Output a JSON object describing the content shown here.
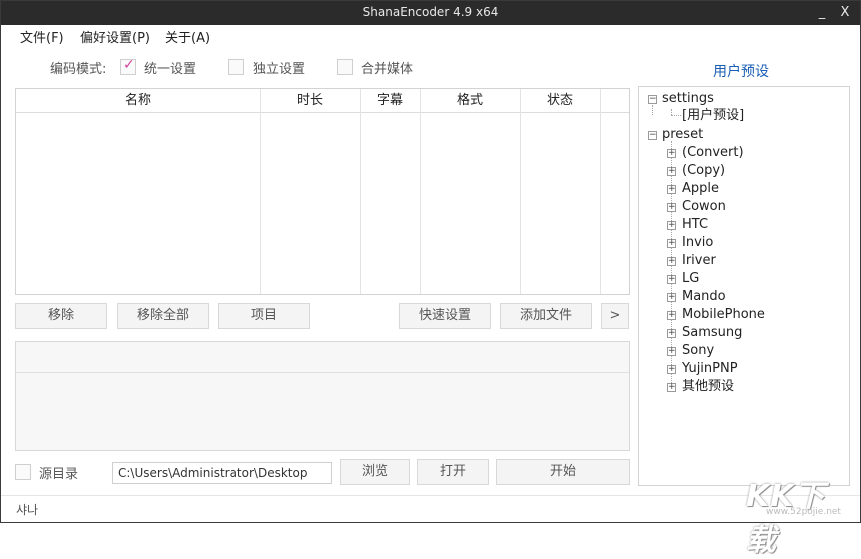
{
  "window": {
    "title": "ShanaEncoder 4.9 x64",
    "minimize": "_",
    "close": "X"
  },
  "menu": [
    "文件(F)",
    "偏好设置(P)",
    "关于(A)"
  ],
  "encode_mode": {
    "label": "编码模式:",
    "unified": {
      "label": "统一设置",
      "checked": true
    },
    "independent": {
      "label": "独立设置",
      "checked": false
    },
    "merge": {
      "label": "合并媒体",
      "checked": false
    }
  },
  "file_list": {
    "columns": [
      "名称",
      "时长",
      "字幕",
      "格式",
      "状态"
    ],
    "rows": []
  },
  "buttons": {
    "remove": "移除",
    "remove_all": "移除全部",
    "items": "项目",
    "quick_settings": "快速设置",
    "add_file": "添加文件",
    "more": ">"
  },
  "output": {
    "source_dir_label": "源目录",
    "source_dir_checked": false,
    "path": "C:\\Users\\Administrator\\Desktop",
    "browse": "浏览",
    "open": "打开",
    "start": "开始"
  },
  "status": "샤나",
  "presets": {
    "title": "用户预设",
    "settings": {
      "label": "settings",
      "children": [
        "[用户预设]"
      ]
    },
    "preset": {
      "label": "preset",
      "children": [
        "(Convert)",
        "(Copy)",
        "Apple",
        "Cowon",
        "HTC",
        "Invio",
        "Iriver",
        "LG",
        "Mando",
        "MobilePhone",
        "Samsung",
        "Sony",
        "YujinPNP",
        "其他预设"
      ]
    }
  },
  "watermark": {
    "text": "KK下载",
    "url": "www.52pojie.net"
  },
  "colors": {
    "titlebar": "#2b2b2b",
    "accent_blue": "#1a5fb4",
    "check_pink": "#d2459c"
  }
}
